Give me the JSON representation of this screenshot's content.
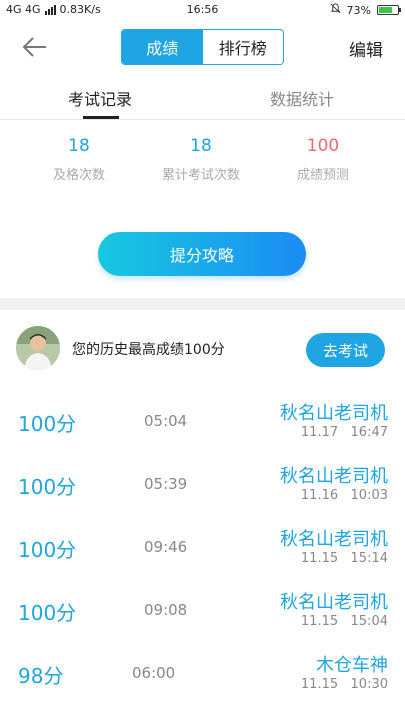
{
  "status_bar": {
    "network": "4G 4G",
    "speed": "0.83K/s",
    "time": "16:56",
    "battery": "73%",
    "battery_level": 0.73
  },
  "header": {
    "segments": [
      "成绩",
      "排行榜"
    ],
    "active_segment": 0,
    "edit_label": "编辑"
  },
  "tabs": [
    "考试记录",
    "数据统计"
  ],
  "stats": [
    {
      "value": "18",
      "label": "及格次数",
      "color": "#1fa4e4"
    },
    {
      "value": "18",
      "label": "累计考试次数",
      "color": "#1fa4e4"
    },
    {
      "value": "100",
      "label": "成绩预测",
      "color": "#f26b6b"
    }
  ],
  "tips_button": "提分攻略",
  "best": {
    "text": "您的历史最高成绩100分",
    "go_button": "去考试"
  },
  "records": [
    {
      "score": "100分",
      "duration": "05:04",
      "name": "秋名山老司机",
      "date": "11.17",
      "time": "16:47"
    },
    {
      "score": "100分",
      "duration": "05:39",
      "name": "秋名山老司机",
      "date": "11.16",
      "time": "10:03"
    },
    {
      "score": "100分",
      "duration": "09:46",
      "name": "秋名山老司机",
      "date": "11.15",
      "time": "15:14"
    },
    {
      "score": "100分",
      "duration": "09:08",
      "name": "秋名山老司机",
      "date": "11.15",
      "time": "15:04"
    },
    {
      "score": "98分",
      "duration": "06:00",
      "name": "木仓车神",
      "date": "11.15",
      "time": "10:30"
    }
  ],
  "colors": {
    "accent": "#1fa4e4",
    "predict": "#f26b6b"
  }
}
